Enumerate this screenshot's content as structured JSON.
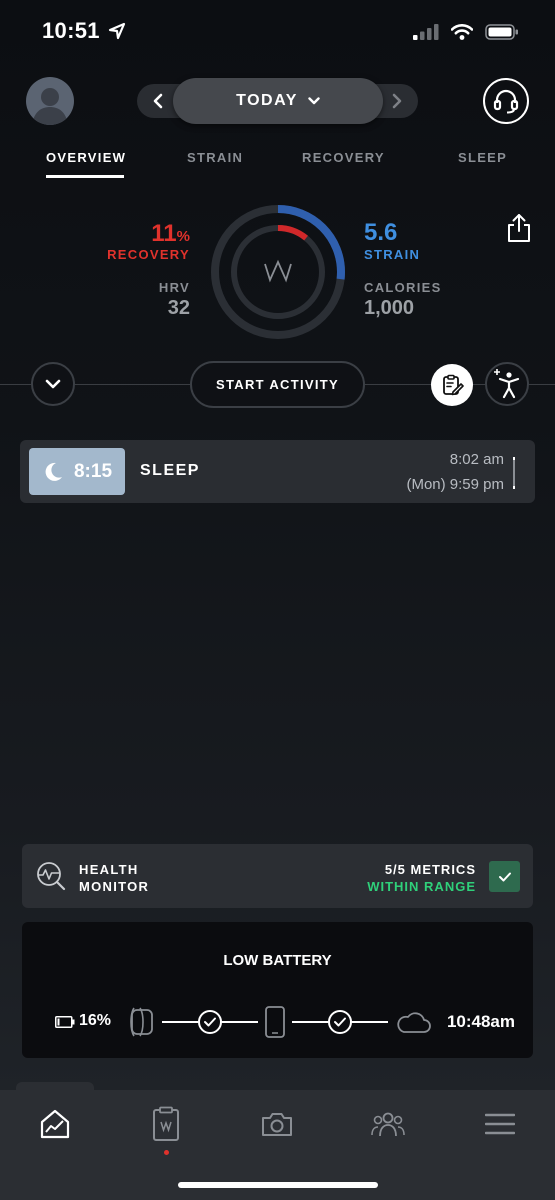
{
  "status_bar": {
    "time": "10:51",
    "icons": [
      "location-arrow-icon",
      "signal-icon",
      "wifi-icon",
      "battery-icon"
    ]
  },
  "header": {
    "day_selector": "TODAY",
    "prev_icon": "chevron-left-icon",
    "next_icon": "chevron-right-icon",
    "support_icon": "headset-icon"
  },
  "tabs": [
    {
      "label": "OVERVIEW",
      "active": true
    },
    {
      "label": "STRAIN",
      "active": false
    },
    {
      "label": "RECOVERY",
      "active": false
    },
    {
      "label": "SLEEP",
      "active": false
    }
  ],
  "overview": {
    "recovery": {
      "value": "11",
      "unit": "%",
      "label": "RECOVERY",
      "fraction": 0.11,
      "color": "#e0322c"
    },
    "hrv": {
      "label": "HRV",
      "value": "32"
    },
    "strain": {
      "value": "5.6",
      "label": "STRAIN",
      "fraction": 0.268,
      "color": "#3f8fe0"
    },
    "calories": {
      "label": "CALORIES",
      "value": "1,000"
    }
  },
  "activity": {
    "start_label": "START ACTIVITY",
    "expand_icon": "chevron-down-icon",
    "journal_icon": "journal-icon",
    "add_activity_icon": "add-activity-icon"
  },
  "sleep_entry": {
    "duration": "8:15",
    "label": "SLEEP",
    "end_time": "8:02 am",
    "start_time": "(Mon) 9:59 pm"
  },
  "health_monitor": {
    "title_line1": "HEALTH",
    "title_line2": "MONITOR",
    "metrics_count": "5/5 METRICS",
    "metrics_status": "WITHIN RANGE",
    "status_color": "#2fd07a"
  },
  "battery_card": {
    "title": "LOW BATTERY",
    "battery_percent": "16%",
    "battery_fraction": 0.16,
    "last_sync": "10:48am"
  },
  "bottom_nav": [
    {
      "name": "overview-icon",
      "active": true
    },
    {
      "name": "journal-clipboard-icon",
      "active": false,
      "has_badge": true
    },
    {
      "name": "camera-icon",
      "active": false
    },
    {
      "name": "teams-icon",
      "active": false
    },
    {
      "name": "menu-icon",
      "active": false
    }
  ]
}
